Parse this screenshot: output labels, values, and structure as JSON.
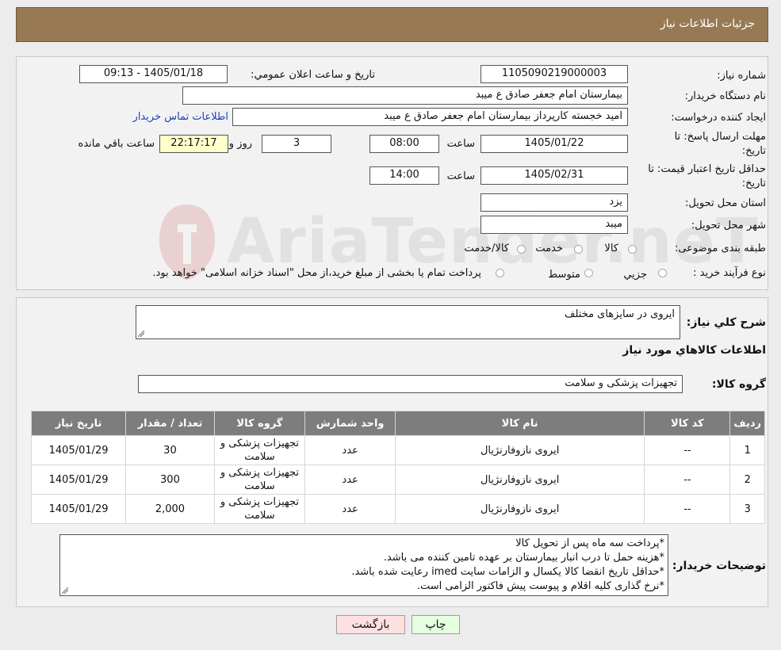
{
  "header": {
    "title": "جزئیات اطلاعات نیاز"
  },
  "form": {
    "need_number": {
      "label": "شماره نیاز:",
      "value": "1105090219000003"
    },
    "announce_datetime": {
      "label": "تاريخ و ساعت اعلان عمومي:",
      "value": "1405/01/18 - 09:13"
    },
    "buyer_org": {
      "label": "نام دستگاه خريدار:",
      "value": "بیمارستان امام جعفر صادق  ع  میبد"
    },
    "requester": {
      "label": "ايجاد کننده درخواست:",
      "value": "امید خجسته کارپرداز بیمارستان امام جعفر صادق  ع  میبد",
      "contact_link": "اطلاعات تماس خريدار"
    },
    "response_deadline": {
      "label_line1": "مهلت ارسال پاسخ: تا",
      "label_line2": "تاريخ:",
      "date": "1405/01/22",
      "time_label": "ساعت",
      "time": "08:00",
      "days": "3",
      "days_label": "روز و",
      "remaining": "22:17:17",
      "remaining_label": "ساعت باقي مانده"
    },
    "price_validity": {
      "label_line1": "حداقل تاريخ اعتبار قيمت: تا",
      "label_line2": "تاريخ:",
      "date": "1405/02/31",
      "time_label": "ساعت",
      "time": "14:00"
    },
    "delivery_province": {
      "label": "استان محل تحويل:",
      "value": "یزد"
    },
    "delivery_city": {
      "label": "شهر محل تحويل:",
      "value": "میبد"
    },
    "category": {
      "label": "طبقه بندی موضوعی:",
      "options": [
        "کالا",
        "خدمت",
        "کالا/خدمت"
      ]
    },
    "process_type": {
      "label": "نوع فرآيند خريد :",
      "options": [
        "جزيي",
        "متوسط"
      ],
      "note": "پرداخت تمام یا بخشی از مبلغ خرید،از محل \"اسناد خزانه اسلامی\" خواهد بود."
    }
  },
  "description": {
    "label": "شرح كلي نياز:",
    "value": "ایروی در سایزهای مختلف"
  },
  "goods_section": {
    "title": "اطلاعات كالاهاي مورد نياز",
    "group_label": "گروه کالا:",
    "group_value": "تجهیزات پزشکی و سلامت"
  },
  "table": {
    "headers": [
      "رديف",
      "كد كالا",
      "نام كالا",
      "واحد شمارش",
      "گروه كالا",
      "تعداد / مقدار",
      "تاريخ نياز"
    ],
    "rows": [
      {
        "index": "1",
        "code": "--",
        "name": "ایروی نازوفارنژیال",
        "unit": "عدد",
        "group": "تجهیزات پزشکی و سلامت",
        "qty": "30",
        "date": "1405/01/29"
      },
      {
        "index": "2",
        "code": "--",
        "name": "ایروی نازوفارنژیال",
        "unit": "عدد",
        "group": "تجهیزات پزشکی و سلامت",
        "qty": "300",
        "date": "1405/01/29"
      },
      {
        "index": "3",
        "code": "--",
        "name": "ایروی نازوفارنژیال",
        "unit": "عدد",
        "group": "تجهیزات پزشکی و سلامت",
        "qty": "2,000",
        "date": "1405/01/29"
      }
    ]
  },
  "buyer_notes": {
    "label": "توضيحات خريدار:",
    "lines": [
      "*پرداخت سه ماه پس از تحویل کالا",
      "*هزینه حمل تا درب انبار بیمارستان بر عهده تامین کننده می باشد.",
      "*حداقل تاریخ انقضا کالا یکسال و الزامات سایت imed رعایت شده باشد.",
      "*نرخ گذاری کلیه اقلام و پیوست پیش فاکتور الزامی است."
    ]
  },
  "buttons": {
    "print": "چاپ",
    "back": "بازگشت"
  },
  "watermark": {
    "text": "AriaTender.neT"
  },
  "colors": {
    "header_bg": "#977a53",
    "table_header_bg": "#7d7d7d",
    "back_button_bg": "#ffe0e0",
    "print_button_bg": "#e6ffe0",
    "link": "#1a3fbf"
  }
}
